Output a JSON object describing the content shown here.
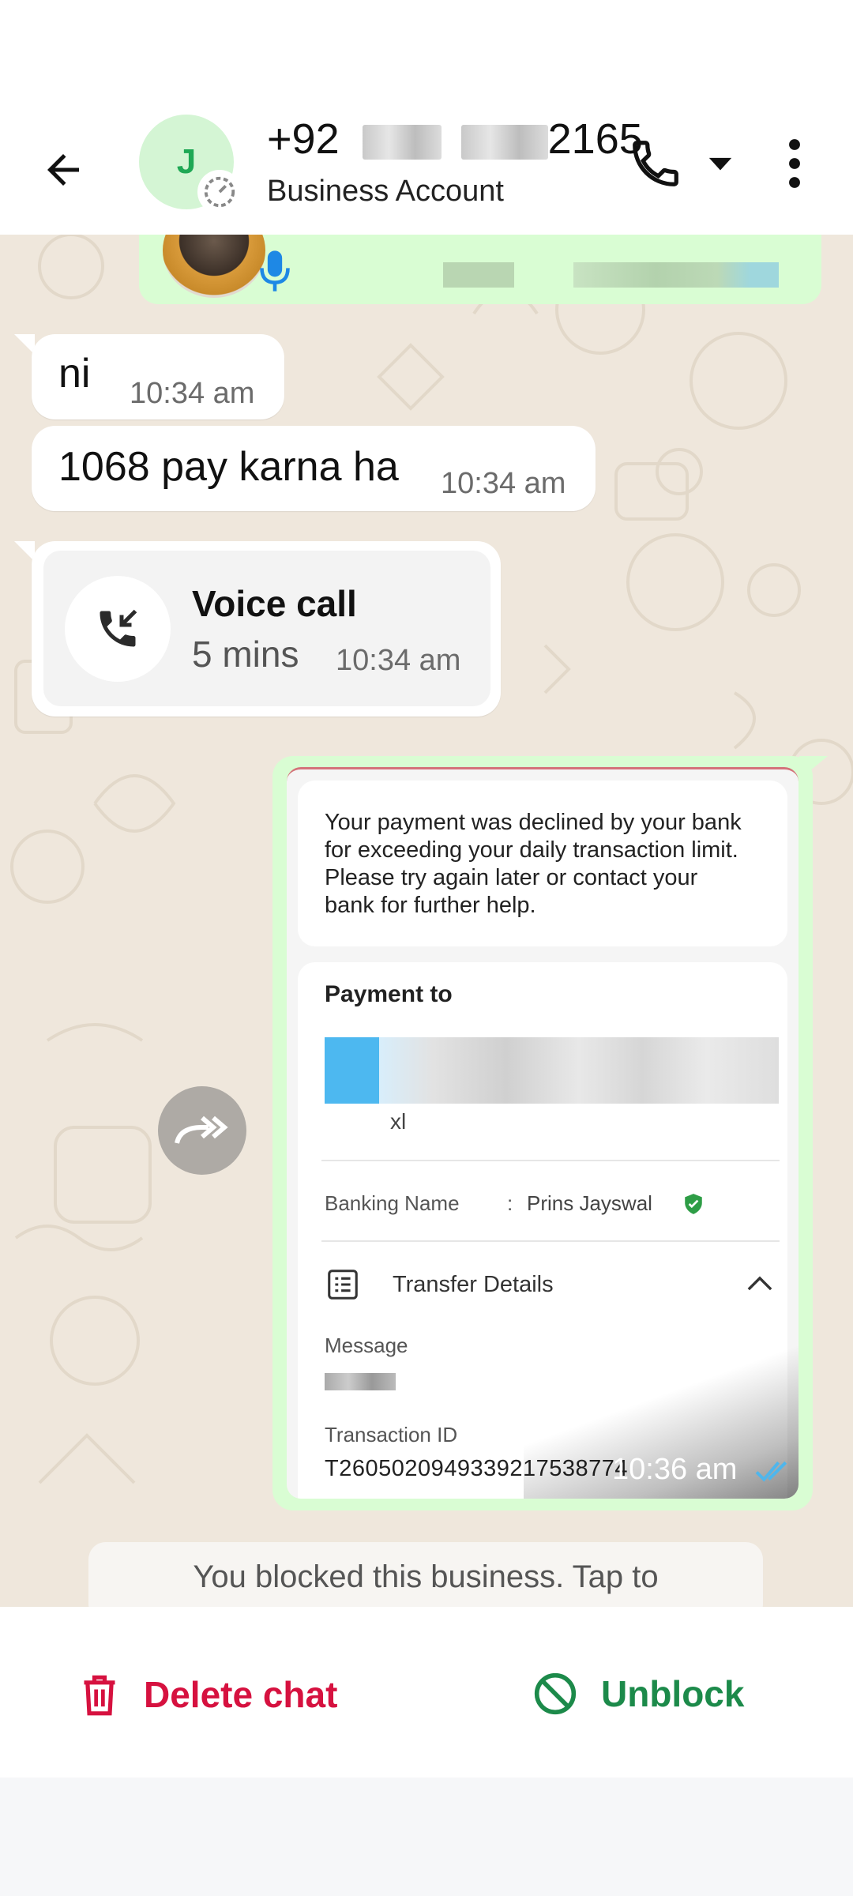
{
  "header": {
    "contact_name_prefix": "+92",
    "contact_name_suffix": "2165",
    "avatar_letter": "J",
    "subtitle": "Business Account"
  },
  "messages": [
    {
      "text": "ni",
      "time": "10:34 am"
    },
    {
      "text": "1068 pay karna ha",
      "time": "10:34 am"
    }
  ],
  "call": {
    "title": "Voice call",
    "duration": "5 mins",
    "time": "10:34 am"
  },
  "shared_screenshot": {
    "decline_message": "Your payment was declined by your bank\nfor exceeding your daily transaction limit.\nPlease try again later or contact your\nbank for further help.",
    "payment_to_label": "Payment to",
    "payee_sub": "xl",
    "banking_name_label": "Banking Name",
    "banking_name_colon": ":",
    "banking_name_value": "Prins Jayswal",
    "transfer_details_label": "Transfer Details",
    "message_label": "Message",
    "transaction_id_label": "Transaction ID",
    "transaction_id_value": "T2605020949339217538774"
  },
  "outgoing_time": "10:36 am",
  "blocked_notice": "You blocked this business. Tap to",
  "actions": {
    "delete_label": "Delete chat",
    "unblock_label": "Unblock"
  },
  "colors": {
    "outgoing_bubble": "#d9fdd3",
    "delete": "#d6113f",
    "unblock": "#1c8a4a",
    "chat_bg": "#efe7dc"
  }
}
